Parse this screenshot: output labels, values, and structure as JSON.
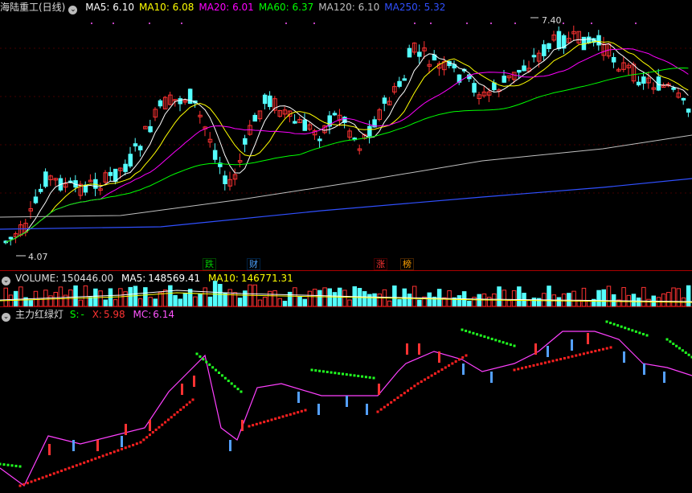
{
  "main_header": {
    "title": "海陆重工(日线)",
    "indicators": [
      {
        "label": "MA5:",
        "value": "6.10",
        "color": "#ffffff"
      },
      {
        "label": "MA10:",
        "value": "6.08",
        "color": "#ffff00"
      },
      {
        "label": "MA20:",
        "value": "6.01",
        "color": "#ff00ff"
      },
      {
        "label": "MA60:",
        "value": "6.37",
        "color": "#00ff00"
      },
      {
        "label": "MA120:",
        "value": "6.10",
        "color": "#c0c0c0"
      },
      {
        "label": "MA250:",
        "value": "5.32",
        "color": "#3050ff"
      }
    ]
  },
  "annotations": {
    "high": "7.40",
    "low": "4.07"
  },
  "event_tags": [
    {
      "text": "跌",
      "color": "#00cc00"
    },
    {
      "text": "财",
      "color": "#4aa0ff"
    },
    {
      "text": "涨",
      "color": "#ff3333"
    },
    {
      "text": "榜",
      "color": "#ffa000"
    }
  ],
  "volume_header": {
    "title": "VOLUME:",
    "value": "150446.00",
    "ma5_label": "MA5:",
    "ma5": "148569.41",
    "ma10_label": "MA10:",
    "ma10": "146771.31"
  },
  "indicator_header": {
    "title": "主力红绿灯",
    "s_label": "S:",
    "s_value": "-",
    "x_label": "X:",
    "x_value": "5.98",
    "mc_label": "MC:",
    "mc_value": "6.14"
  },
  "colors": {
    "up": "#ff3232",
    "down": "#54ffff",
    "ma5": "#ffffff",
    "ma10": "#ffff00",
    "ma20": "#ff00ff",
    "ma60": "#00ff00",
    "ma120": "#c0c0c0",
    "ma250": "#3050ff"
  }
}
